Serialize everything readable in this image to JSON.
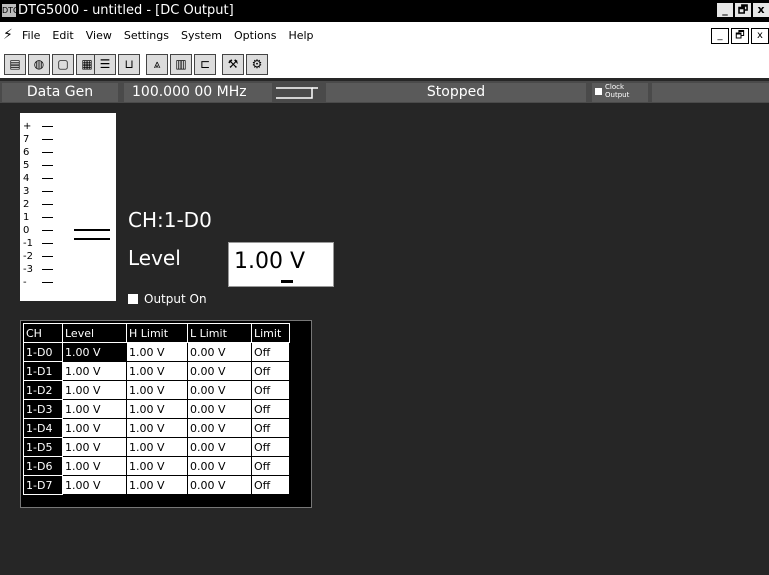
{
  "window": {
    "app_icon": "DTG",
    "title": "DTG5000 - untitled - [DC Output]",
    "buttons": [
      "_",
      "🗗",
      "x"
    ]
  },
  "menu": {
    "icon": "menu-connector-icon",
    "items": [
      "File",
      "Edit",
      "View",
      "Settings",
      "System",
      "Options",
      "Help"
    ],
    "mdi_buttons": [
      "_",
      "🗗",
      "x"
    ]
  },
  "toolbar": {
    "group1": [
      "print-icon",
      "open-icon",
      "save-icon",
      "grid-icon"
    ],
    "group2": [
      "bars-icon",
      "waveform-icon"
    ],
    "group3": [
      "pattern-icon",
      "block-icon",
      "sequence-icon"
    ],
    "group4": [
      "settings-icon",
      "run-icon"
    ]
  },
  "status": {
    "mode": "Data Gen",
    "frequency": "100.000 00 MHz",
    "state": "Stopped",
    "clock_output": "Clock Output"
  },
  "scale": {
    "labels": [
      "+",
      "7",
      "6",
      "5",
      "4",
      "3",
      "2",
      "1",
      "0",
      "-1",
      "-2",
      "-3",
      "-"
    ]
  },
  "channel": {
    "label": "CH:1-D0",
    "level_label": "Level",
    "level_value": "1.00 V",
    "output_on_label": "Output On"
  },
  "table": {
    "headers": [
      "CH",
      "Level",
      "H Limit",
      "L Limit",
      "Limit"
    ],
    "rows": [
      [
        "1-D0",
        "1.00 V",
        "1.00 V",
        "0.00 V",
        "Off"
      ],
      [
        "1-D1",
        "1.00 V",
        "1.00 V",
        "0.00 V",
        "Off"
      ],
      [
        "1-D2",
        "1.00 V",
        "1.00 V",
        "0.00 V",
        "Off"
      ],
      [
        "1-D3",
        "1.00 V",
        "1.00 V",
        "0.00 V",
        "Off"
      ],
      [
        "1-D4",
        "1.00 V",
        "1.00 V",
        "0.00 V",
        "Off"
      ],
      [
        "1-D5",
        "1.00 V",
        "1.00 V",
        "0.00 V",
        "Off"
      ],
      [
        "1-D6",
        "1.00 V",
        "1.00 V",
        "0.00 V",
        "Off"
      ],
      [
        "1-D7",
        "1.00 V",
        "1.00 V",
        "0.00 V",
        "Off"
      ]
    ]
  }
}
